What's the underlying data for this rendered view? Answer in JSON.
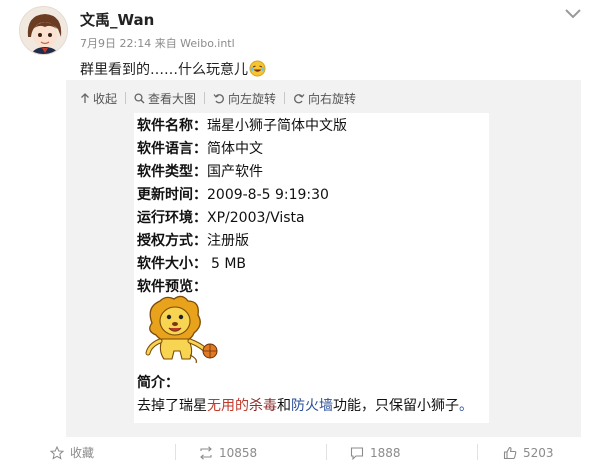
{
  "post": {
    "username": "文禹_Wan",
    "meta": "7月9日 22:14 来自 Weibo.intl",
    "text": "群里看到的……什么玩意儿"
  },
  "toolbar": {
    "collapse": "收起",
    "view_large": "查看大图",
    "rotate_left": "向左旋转",
    "rotate_right": "向右旋转"
  },
  "document": {
    "rows": [
      {
        "label": "软件名称：",
        "value": "瑞星小狮子简体中文版"
      },
      {
        "label": "软件语言：",
        "value": "简体中文"
      },
      {
        "label": "软件类型：",
        "value": "国产软件"
      },
      {
        "label": "更新时间：",
        "value": "2009-8-5 9:19:30"
      },
      {
        "label": "运行环境：",
        "value": "XP/2003/Vista"
      },
      {
        "label": "授权方式：",
        "value": "注册版"
      },
      {
        "label": "软件大小：",
        "value": "5 MB"
      },
      {
        "label": "软件预览：",
        "value": ""
      }
    ],
    "intro_label": "简介：",
    "intro": {
      "p1": "去掉了瑞星",
      "p2": "无用的",
      "p3": "杀毒",
      "p4": "和",
      "p5": "防火墙",
      "p6": "功能，只保留小狮子",
      "p7": "。"
    }
  },
  "actions": {
    "favorite": "收藏",
    "reposts": "10858",
    "comments": "1888",
    "likes": "5203"
  },
  "icons": {
    "collapse": "up-arrow-icon",
    "view_large": "magnifier-icon",
    "rotate_left": "rotate-left-icon",
    "rotate_right": "rotate-right-icon",
    "favorite": "star-icon",
    "repost": "repost-icon",
    "comment": "comment-icon",
    "like": "thumbs-up-icon",
    "menu": "chevron-down-icon"
  }
}
